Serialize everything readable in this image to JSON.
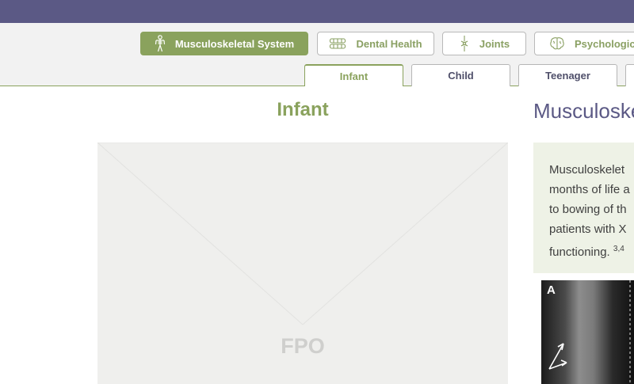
{
  "header": {
    "categories": [
      {
        "label": "Musculoskeletal System",
        "icon": "skeleton-icon",
        "active": true
      },
      {
        "label": "Dental Health",
        "icon": "teeth-icon",
        "active": false
      },
      {
        "label": "Joints",
        "icon": "joint-icon",
        "active": false
      },
      {
        "label": "Psychologica",
        "icon": "brain-icon",
        "active": false
      }
    ],
    "tabs": [
      {
        "label": "Infant",
        "active": true
      },
      {
        "label": "Child",
        "active": false
      },
      {
        "label": "Teenager",
        "active": false
      }
    ]
  },
  "main": {
    "title": "Infant",
    "placeholder_label": "FPO"
  },
  "side": {
    "title": "Musculoske",
    "info_lines": [
      "Musculoskelet",
      "months of life a",
      "to bowing of th",
      "patients with X",
      "functioning."
    ],
    "info_superscript": "3,4",
    "xray_label": "A"
  },
  "colors": {
    "brand_purple": "#5b5985",
    "accent_green": "#8aa25d",
    "info_box": "#eef2e6"
  }
}
